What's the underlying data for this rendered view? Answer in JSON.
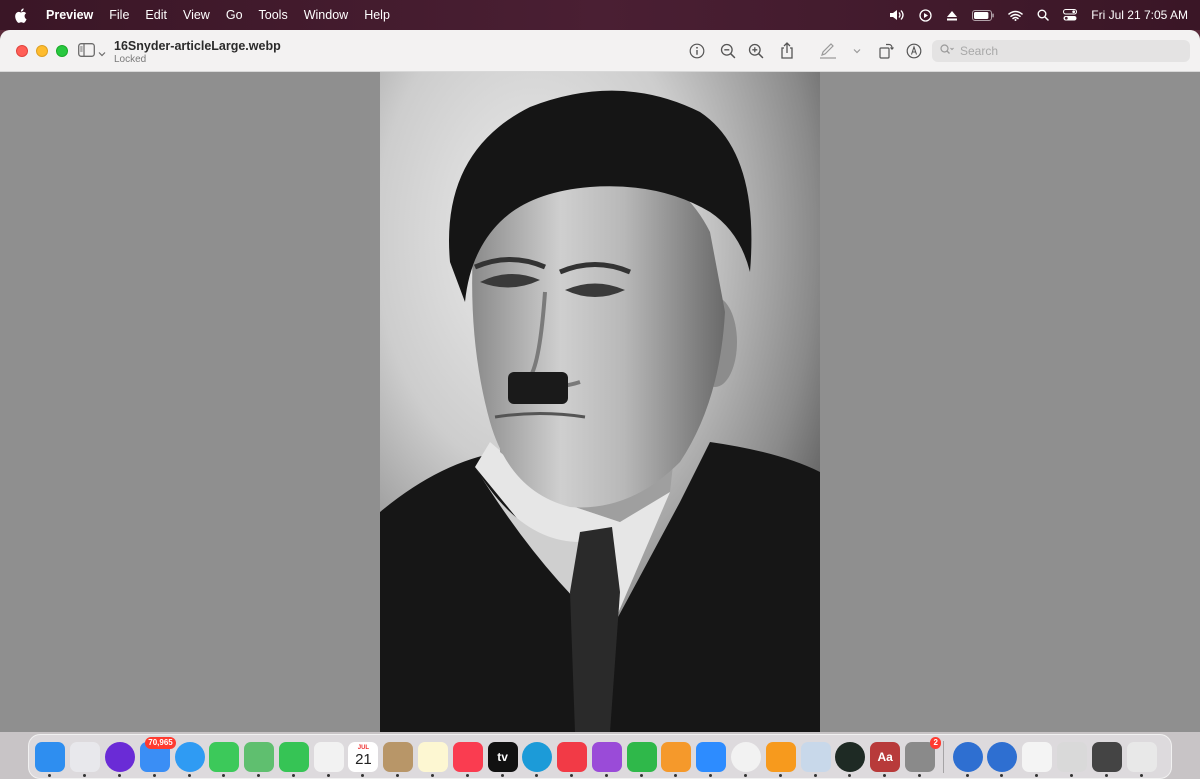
{
  "menubar": {
    "app_name": "Preview",
    "items": [
      "File",
      "Edit",
      "View",
      "Go",
      "Tools",
      "Window",
      "Help"
    ],
    "datetime": "Fri Jul 21  7:05 AM",
    "battery_level": 0.9
  },
  "window": {
    "title": "16Snyder-articleLarge.webp",
    "subtitle": "Locked",
    "search_placeholder": "Search"
  },
  "dock": {
    "apps": [
      {
        "name": "Finder",
        "color": "#2e8ef0"
      },
      {
        "name": "Launchpad",
        "color": "#e8e8ec"
      },
      {
        "name": "Firefox",
        "color": "#6a2bd6"
      },
      {
        "name": "Mail",
        "color": "#3a8ef5",
        "badge": "70,965"
      },
      {
        "name": "Safari",
        "color": "#2f9bf3"
      },
      {
        "name": "Messages",
        "color": "#3cc95a"
      },
      {
        "name": "Maps",
        "color": "#5fbf6f"
      },
      {
        "name": "FaceTime",
        "color": "#36c455"
      },
      {
        "name": "Photos",
        "color": "#f2f2f2"
      },
      {
        "name": "Calendar",
        "color": "#ffffff",
        "month": "JUL",
        "day": "21"
      },
      {
        "name": "Contacts",
        "color": "#b89668"
      },
      {
        "name": "Notes",
        "color": "#fdf7d2"
      },
      {
        "name": "Music",
        "color": "#fa3c50"
      },
      {
        "name": "TV",
        "color": "#111111",
        "label": "tv"
      },
      {
        "name": "Edge",
        "color": "#1c9bd8"
      },
      {
        "name": "News",
        "color": "#f23a46"
      },
      {
        "name": "Podcasts",
        "color": "#9a4bd8"
      },
      {
        "name": "Numbers",
        "color": "#2fb84a"
      },
      {
        "name": "Pages",
        "color": "#f5992b"
      },
      {
        "name": "Zoom",
        "color": "#2d8cff"
      },
      {
        "name": "Chrome",
        "color": "#f2f2f2"
      },
      {
        "name": "Books",
        "color": "#f79a1d"
      },
      {
        "name": "Preview",
        "color": "#c8d8ea"
      },
      {
        "name": "Activity Monitor",
        "color": "#1e2a24"
      },
      {
        "name": "Dictionary",
        "color": "#b83a3a",
        "label": "Aa"
      },
      {
        "name": "System Settings",
        "color": "#8a8a8a",
        "badge": "2"
      }
    ],
    "others": [
      {
        "name": "Globe 1",
        "color": "#2e6fd1"
      },
      {
        "name": "Globe 2",
        "color": "#2e6fd1"
      },
      {
        "name": "Document",
        "color": "#f4f4f4"
      },
      {
        "name": "Screenshot",
        "color": "#d9d9d9"
      },
      {
        "name": "Folder stack",
        "color": "#444444"
      },
      {
        "name": "Trash",
        "color": "#e8e8e8"
      }
    ]
  }
}
